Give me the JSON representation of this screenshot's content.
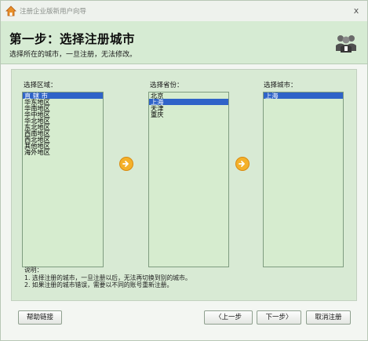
{
  "window": {
    "title": "注册企业版新用户向导",
    "close_glyph": "x"
  },
  "header": {
    "step_title": "第一步：选择注册城市",
    "subtitle": "选择所在的城市，一旦注册，无法修改。"
  },
  "region": {
    "label": "选择区域：",
    "items": [
      "直 辖 市",
      "华东地区",
      "华南地区",
      "华中地区",
      "华北地区",
      "东北地区",
      "西南地区",
      "西北地区",
      "其他地区",
      "海外地区"
    ],
    "selected": "直 辖 市"
  },
  "province": {
    "label": "选择省份：",
    "items": [
      "北京",
      "上海",
      "天津",
      "重庆"
    ],
    "selected": "上海"
  },
  "city": {
    "label": "选择城市：",
    "items": [
      "上海"
    ],
    "selected": "上海"
  },
  "notes": {
    "title": "说明：",
    "line1": "1. 选择注册的城市，一旦注册以后，无法再切换到别的城市。",
    "line2": "2. 如果注册的城市错误，需要以不同的账号重新注册。"
  },
  "buttons": {
    "help": "帮助链接",
    "prev": "〈上一步",
    "next": "下一步〉",
    "cancel": "取消注册"
  },
  "colors": {
    "selection": "#2f63c8",
    "header_bg": "#d6ebd3",
    "list_bg": "#d6eccf",
    "arrow": "#f4b12a"
  }
}
